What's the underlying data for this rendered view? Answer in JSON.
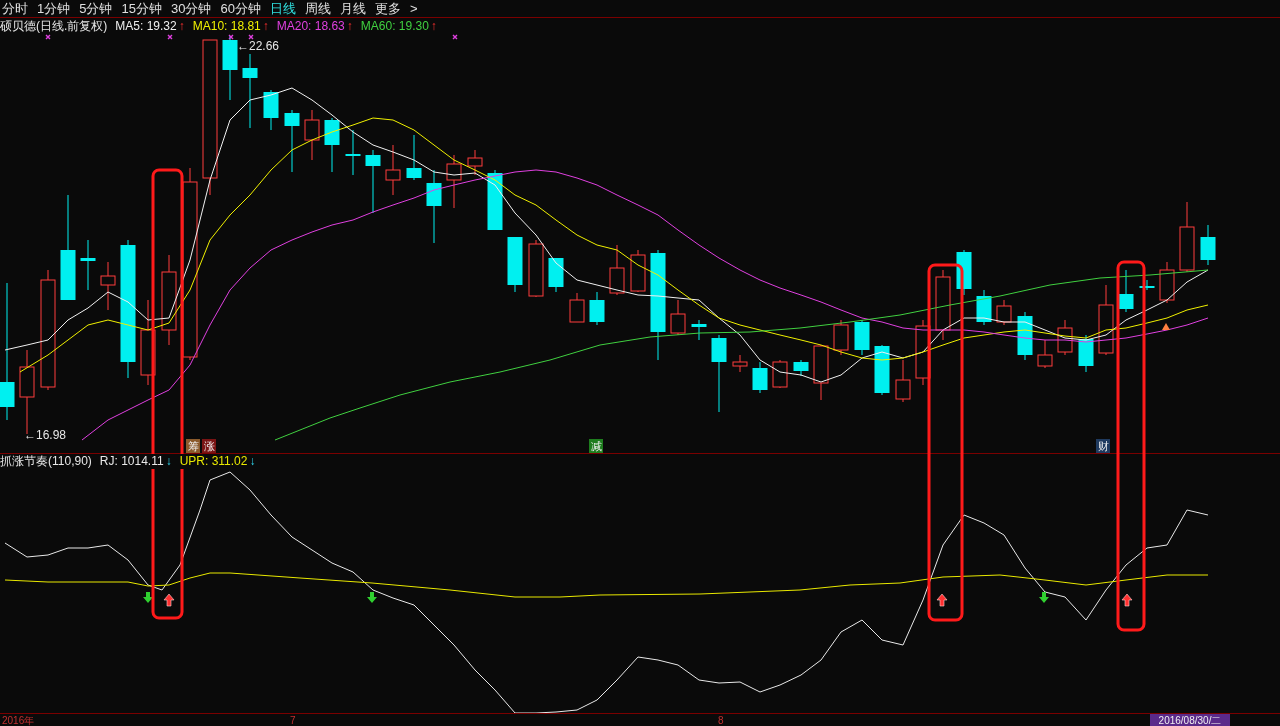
{
  "menu": {
    "items": [
      {
        "label": "分时",
        "selected": false
      },
      {
        "label": "1分钟",
        "selected": false
      },
      {
        "label": "5分钟",
        "selected": false
      },
      {
        "label": "15分钟",
        "selected": false
      },
      {
        "label": "30分钟",
        "selected": false
      },
      {
        "label": "60分钟",
        "selected": false
      },
      {
        "label": "日线",
        "selected": true
      },
      {
        "label": "周线",
        "selected": false
      },
      {
        "label": "月线",
        "selected": false
      },
      {
        "label": "更多",
        "selected": false
      }
    ],
    "more_arrow": ">"
  },
  "main_panel": {
    "title": "硕贝德(日线.前复权)",
    "indicators": [
      {
        "label": "MA5: 19.32",
        "arrow": "↑",
        "color": "#f0f0f0"
      },
      {
        "label": "MA10: 18.81",
        "arrow": "↑",
        "color": "#f0f000"
      },
      {
        "label": "MA20: 18.63",
        "arrow": "↑",
        "color": "#e040e0"
      },
      {
        "label": "MA60: 19.30",
        "arrow": "↑",
        "color": "#40d040"
      }
    ],
    "high_label": "←22.66",
    "low_label": "←16.98",
    "events": [
      {
        "text": "筹",
        "color": "#8b5a2b"
      },
      {
        "text": "涨",
        "color": "#7a1414"
      },
      {
        "text": "减",
        "color": "#1e7d1e"
      },
      {
        "text": "财",
        "color": "#1f3a5f"
      }
    ]
  },
  "indicator_panel": {
    "title": "抓涨节奏(110,90)",
    "readings": [
      {
        "label": "RJ: 1014.11",
        "arrow": "↓",
        "color": "#e8e8e8"
      },
      {
        "label": "UPR: 311.02",
        "arrow": "↓",
        "color": "#e8e800"
      }
    ]
  },
  "time_axis": {
    "labels": [
      "2016年",
      "7",
      "8"
    ],
    "cursor_date": "2016/08/30/二"
  }
}
